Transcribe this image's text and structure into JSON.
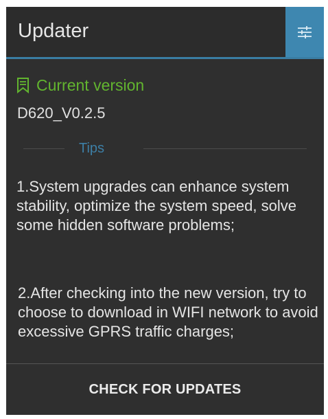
{
  "appbar": {
    "title": "Updater",
    "settings_icon": "sliders-icon",
    "accent_color": "#3e87b0"
  },
  "version": {
    "icon": "bookmark-icon",
    "label": "Current version",
    "value": "D620_V0.2.5",
    "label_color": "#62b52f"
  },
  "tips": {
    "label": "Tips",
    "items": [
      "1.System upgrades can enhance system stability, optimize the system speed, solve some hidden software problems;",
      "2.After checking into the new version, try to choose to download in WIFI network to avoid excessive GPRS traffic charges;"
    ]
  },
  "footer": {
    "check_label": "CHECK FOR UPDATES"
  }
}
